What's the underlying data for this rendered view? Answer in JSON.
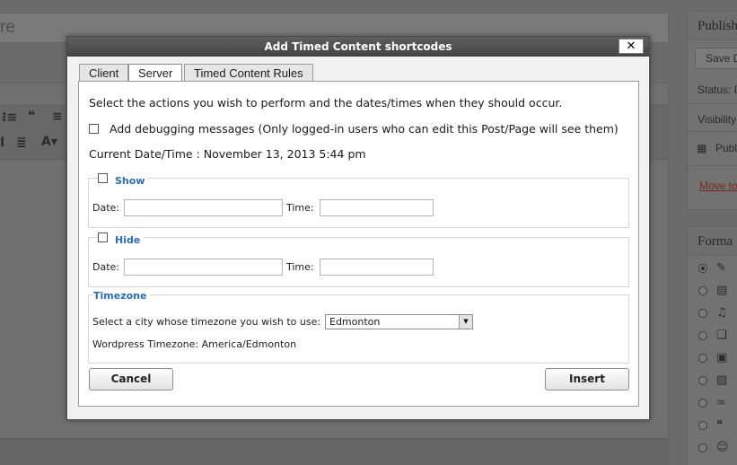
{
  "background": {
    "title_placeholder": "re",
    "toolbar_icons": [
      "numbered-list-icon",
      "blockquote-icon",
      "align-left-icon",
      "italic-icon",
      "align-justify-icon",
      "text-color-icon"
    ],
    "publish_box": {
      "title": "Publish",
      "save_draft_label": "Save D",
      "status_label": "Status: D",
      "visibility_label": "Visibility",
      "publish_label": "Publi",
      "trash_label": "Move to"
    },
    "format_box": {
      "title": "Forma"
    }
  },
  "dialog": {
    "title": "Add Timed Content shortcodes",
    "close_label": "✕",
    "tabs": [
      {
        "label": "Client",
        "active": false
      },
      {
        "label": "Server",
        "active": true
      },
      {
        "label": "Timed Content Rules",
        "active": false
      }
    ],
    "intro_text": "Select the actions you wish to perform and the dates/times when they should occur.",
    "debug_label": "Add debugging messages (Only logged-in users who can edit this Post/Page will see them)",
    "current_datetime": "Current Date/Time : November 13, 2013 5:44 pm",
    "show_group": {
      "legend": "Show",
      "date_label": "Date:",
      "time_label": "Time:",
      "date_value": "",
      "time_value": ""
    },
    "hide_group": {
      "legend": "Hide",
      "date_label": "Date:",
      "time_label": "Time:",
      "date_value": "",
      "time_value": ""
    },
    "timezone_group": {
      "legend": "Timezone",
      "select_label": "Select a city whose timezone you wish to use:",
      "selected_city": "Edmonton",
      "wordpress_timezone": "Wordpress Timezone: America/Edmonton"
    },
    "cancel_label": "Cancel",
    "insert_label": "Insert"
  },
  "colors": {
    "accent_legend": "#2a6fb6",
    "titlebar": "#4a4a4a",
    "trash_link": "#b8332a"
  }
}
